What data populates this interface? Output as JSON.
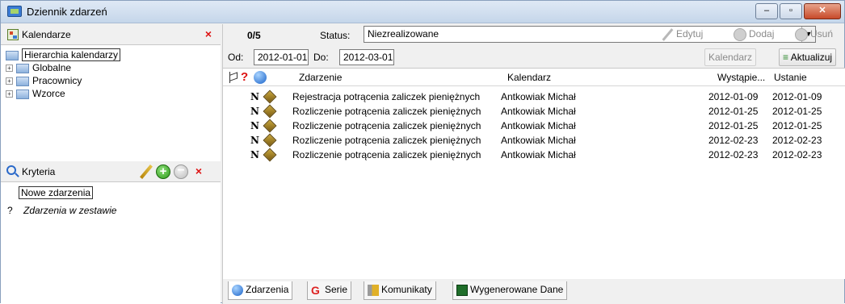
{
  "window": {
    "title": "Dziennik zdarzeń",
    "min_label": "–",
    "max_label": "▫",
    "close_label": "✕"
  },
  "calendars": {
    "header": "Kalendarze",
    "close_label": "×",
    "tree": [
      {
        "label": "Hierarchia kalendarzy",
        "selected": true,
        "expander": ""
      },
      {
        "label": "Globalne",
        "expander": "+"
      },
      {
        "label": "Pracownicy",
        "expander": "+"
      },
      {
        "label": "Wzorce",
        "expander": "+"
      }
    ]
  },
  "criteria": {
    "header": "Kryteria",
    "close_label": "×",
    "add_label": "+",
    "remove_label": "−",
    "items": [
      {
        "prefix": "",
        "label": "Nowe zdarzenia",
        "selected": true
      },
      {
        "prefix": "?",
        "label": "Zdarzenia w zestawie",
        "italic": true
      }
    ]
  },
  "toolbar": {
    "count": "0/5",
    "status_label": "Status:",
    "status_value": "Niezrealizowane",
    "edit_label": "Edytuj",
    "add_label": "Dodaj",
    "delete_label": "Usuń"
  },
  "dates": {
    "from_label": "Od:",
    "from_value": "2012-01-01",
    "to_label": "Do:",
    "to_value": "2012-03-01",
    "calendar_label": "Kalendarz",
    "refresh_label": "Aktualizuj"
  },
  "grid": {
    "q_label": "?",
    "columns": {
      "event": "Zdarzenie",
      "calendar": "Kalendarz",
      "occurrence": "Wystąpie...",
      "setting": "Ustanie"
    },
    "rows": [
      {
        "mark": "N",
        "event": "Rejestracja potrącenia zaliczek pieniężnych",
        "calendar": "Antkowiak Michał",
        "occurrence": "2012-01-09",
        "setting": "2012-01-09"
      },
      {
        "mark": "N",
        "event": "Rozliczenie potrącenia zaliczek pieniężnych",
        "calendar": "Antkowiak Michał",
        "occurrence": "2012-01-25",
        "setting": "2012-01-25"
      },
      {
        "mark": "N",
        "event": "Rozliczenie potrącenia zaliczek pieniężnych",
        "calendar": "Antkowiak Michał",
        "occurrence": "2012-01-25",
        "setting": "2012-01-25"
      },
      {
        "mark": "N",
        "event": "Rozliczenie potrącenia zaliczek pieniężnych",
        "calendar": "Antkowiak Michał",
        "occurrence": "2012-02-23",
        "setting": "2012-02-23"
      },
      {
        "mark": "N",
        "event": "Rozliczenie potrącenia zaliczek pieniężnych",
        "calendar": "Antkowiak Michał",
        "occurrence": "2012-02-23",
        "setting": "2012-02-23"
      }
    ]
  },
  "tabs": [
    {
      "label": "Zdarzenia",
      "icon": "globe-icon",
      "active": true
    },
    {
      "label": "Serie",
      "icon": "serie-icon"
    },
    {
      "label": "Komunikaty",
      "icon": "speaker-icon"
    },
    {
      "label": "Wygenerowane Dane",
      "icon": "data-icon"
    }
  ]
}
